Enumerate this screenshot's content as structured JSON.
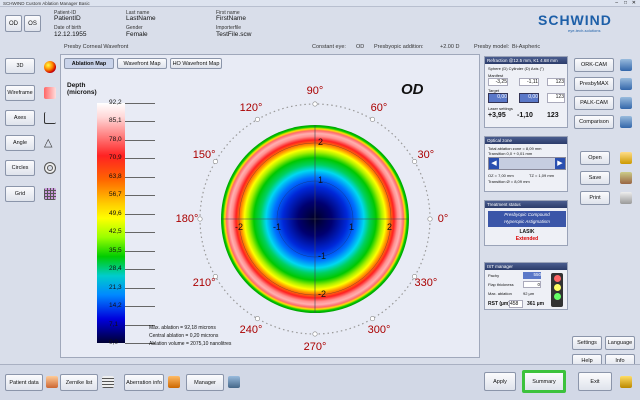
{
  "window": {
    "title": "SCHWIND Custom Ablation Manager Basic"
  },
  "header": {
    "buttons": {
      "od": "OD",
      "os": "OS"
    },
    "patient_id_label": "Patient-ID",
    "patient_id": "PatientID",
    "dob_label": "Date of birth",
    "dob": "12.12.1955",
    "last_name_label": "Last name",
    "last_name": "LastName",
    "gender_label": "Gender",
    "gender": "Female",
    "first_name_label": "First name",
    "first_name": "FirstName",
    "import_label": "Importerfile",
    "import_file": "TestFile.scw",
    "brand": "SCHWIND",
    "brand_sub": "eye-tech-solutions"
  },
  "infobar": {
    "wavefront": "Presby Corneal Wavefront",
    "constant_eye_label": "Constant eye:",
    "constant_eye": "OD",
    "presbyopic_label": "Presbyopic addition:",
    "presbyopic": "+2.00 D",
    "model_label": "Presby model:",
    "model": "Bi-Aspheric"
  },
  "left_nav": [
    "3D",
    "Wireframe",
    "Axes",
    "Angle",
    "Circles",
    "Grid"
  ],
  "tabs": [
    "Ablation Map",
    "Wavefront Map",
    "HO Wavefront Map"
  ],
  "scale": {
    "title": "Depth",
    "unit": "(microns)",
    "values": [
      "92,2",
      "85,1",
      "78,0",
      "70,9",
      "63,8",
      "56,7",
      "49,6",
      "42,5",
      "35,5",
      "28,4",
      "21,3",
      "14,2",
      "7,1",
      "0,0"
    ]
  },
  "map": {
    "eye": "OD",
    "angles": [
      "90°",
      "60°",
      "30°",
      "0°",
      "330°",
      "300°",
      "270°",
      "240°",
      "210°",
      "180°",
      "150°",
      "120°"
    ],
    "axis_ticks": {
      "h": [
        "-2",
        "-1",
        "1",
        "2"
      ],
      "v": [
        "2",
        "1",
        "-1",
        "-2"
      ]
    },
    "stats": [
      "Max. ablation = 92,18 microns",
      "Central ablation = 0,20 microns",
      "Ablation volume = 2075,10 nanolitres"
    ]
  },
  "refraction": {
    "header": "Refraction @12.5 mm, K1 4.68 mm",
    "cols": "Sphere (D)  Cylinder (D)  Axis (°)",
    "manifest_label": "Manifest",
    "manifest": [
      "-3,25",
      "-1,11",
      "123"
    ],
    "target_label": "Target",
    "target": [
      "0,00",
      "0,00",
      "123"
    ],
    "laser_label": "Laser settings",
    "laser": [
      "+3,95",
      "-1,10",
      "123"
    ]
  },
  "optical_zone": {
    "header": "Optical zone",
    "line1": "Total ablation zone = 8,09 mm",
    "line2": "Transition 0,0 + 0,01 mm",
    "oz": "OZ = 7,00 mm",
    "tz": "TZ = 1,09 mm",
    "transition": "Transition Ø = 8,09 mm"
  },
  "treatment": {
    "header": "Treatment status",
    "line1": "Presbyopic Compound",
    "line2": "Hyperopic Astigmatism",
    "method": "LASIK",
    "status": "Extended"
  },
  "ist_manager": {
    "header": "IST manager",
    "pachy_label": "Pachy",
    "pachy": "550",
    "flap_label": "Flap thickness",
    "flap": "0",
    "max_label": "Max. ablation",
    "max": "92 µm",
    "rsb_label": "RST (µm)",
    "rsb": "458",
    "rsb_val": "361 µm"
  },
  "right_buttons": [
    "ORK-CAM",
    "PresbyMAX",
    "PALK-CAM",
    "Comparison",
    "Open",
    "Save",
    "Print",
    "Settings",
    "Language",
    "Help",
    "Info"
  ],
  "bottom": {
    "buttons": [
      "Patient data",
      "Zernike list",
      "Aberration info",
      "Manager",
      "Apply",
      "Summary",
      "Exit"
    ]
  },
  "colors": {
    "accent_green": "#3cc23c",
    "title_blue": "#1d5fa8"
  }
}
